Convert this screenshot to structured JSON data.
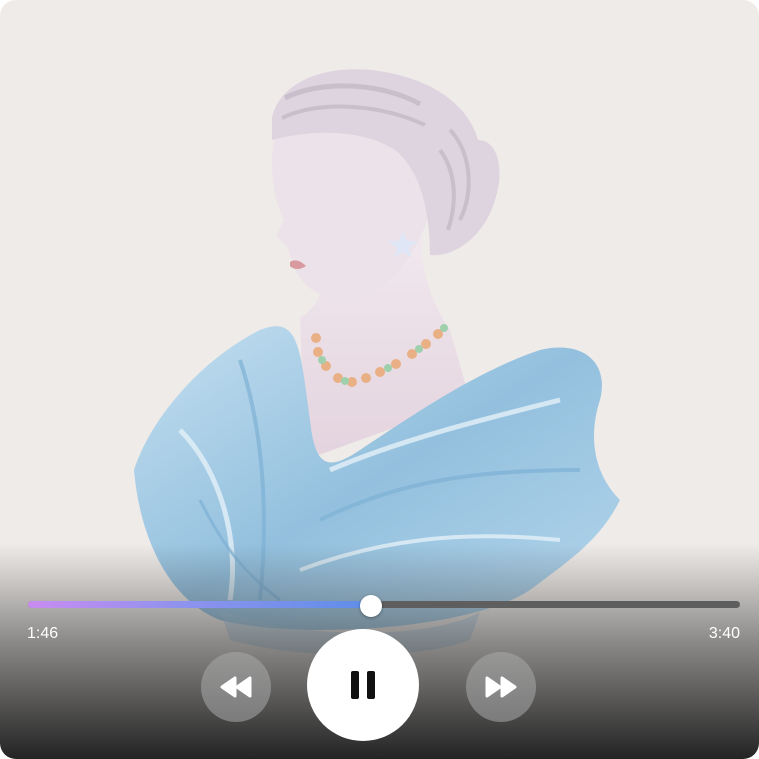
{
  "player": {
    "elapsed": "1:46",
    "total": "3:40",
    "progress": 0.482,
    "state": "playing"
  },
  "controls": {
    "rewind_icon": "rewind-icon",
    "pause_icon": "pause-icon",
    "forward_icon": "fast-forward-icon"
  },
  "colors": {
    "background": "#efebe8",
    "progress_gradient_start": "#c98cf0",
    "progress_gradient_end": "#5f8ee8",
    "track": "#5e5e5e",
    "drapery": "#9cc5e0"
  }
}
